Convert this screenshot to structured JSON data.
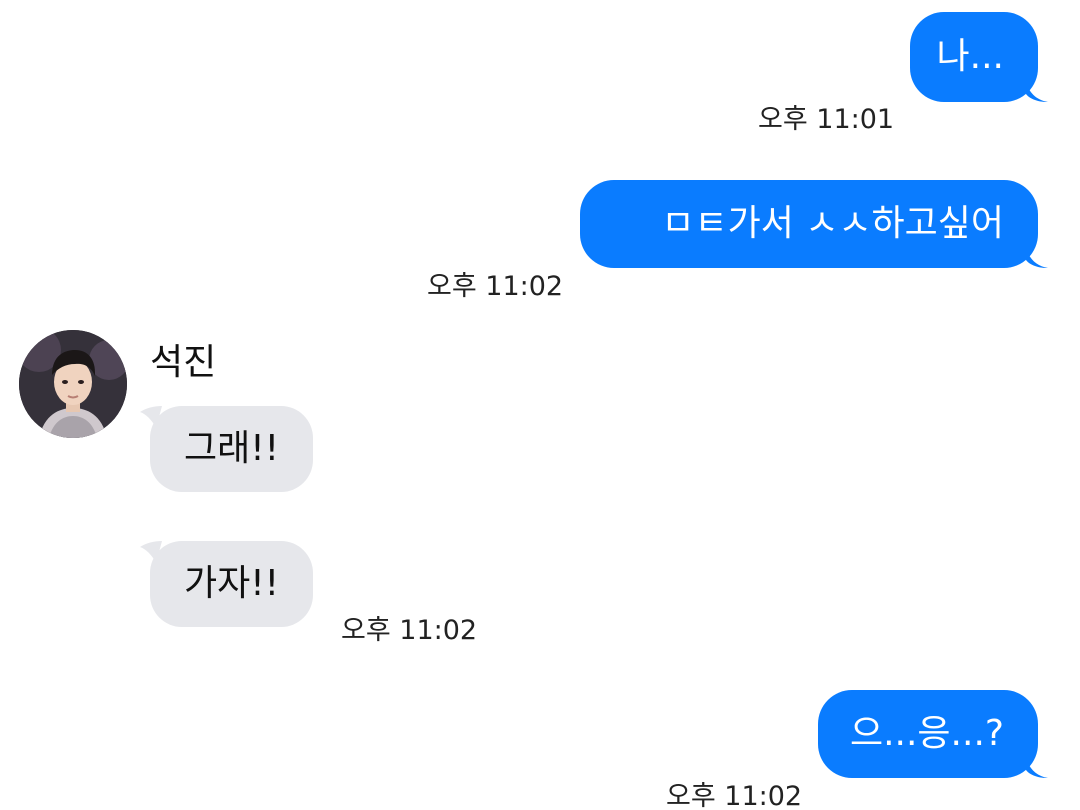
{
  "messages": [
    {
      "direction": "out",
      "text": "나...",
      "time": "오후 11:01"
    },
    {
      "direction": "out",
      "text": "ㅁㅌ가서 ㅅㅅ하고싶어",
      "time": "오후 11:02"
    },
    {
      "direction": "in",
      "sender": "석진",
      "text": "그래!!"
    },
    {
      "direction": "in",
      "text": "가자!!",
      "time": "오후 11:02"
    },
    {
      "direction": "out",
      "text": "으...응...?",
      "time": "오후 11:02"
    }
  ],
  "colors": {
    "outgoing_bubble": "#0a7cff",
    "incoming_bubble": "#e6e7eb",
    "background": "#ffffff"
  },
  "icons": {
    "avatar": "profile-photo"
  }
}
